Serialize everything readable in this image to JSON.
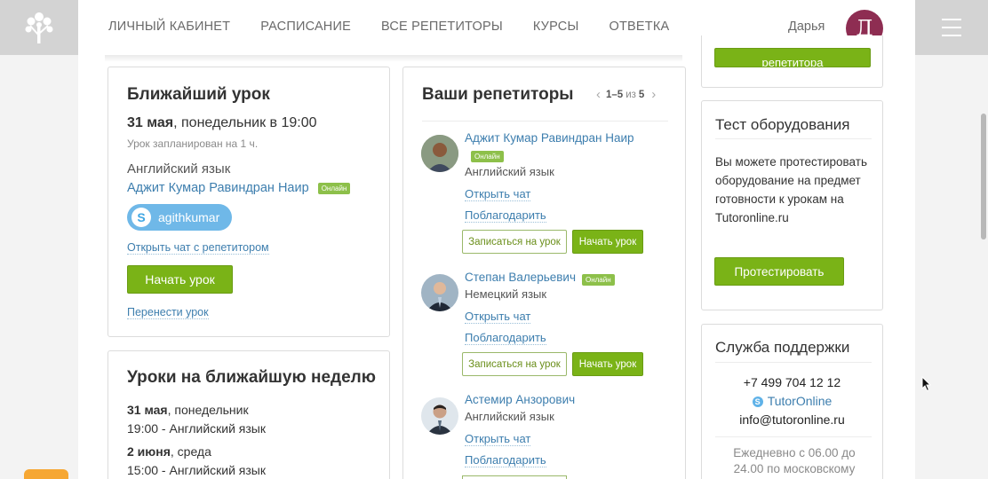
{
  "nav": {
    "items": [
      "ЛИЧНЫЙ КАБИНЕТ",
      "РАСПИСАНИЕ",
      "ВСЕ РЕПЕТИТОРЫ",
      "КУРСЫ",
      "ОТВЕТКА"
    ],
    "user_name": "Дарья",
    "avatar_letter": "Д"
  },
  "next_lesson": {
    "title": "Ближайший урок",
    "date_bold": "31 мая",
    "date_rest": ", понедельник в 19:00",
    "planned": "Урок запланирован на 1 ч.",
    "subject": "Английский язык",
    "tutor": "Аджит Кумар Равиндран Наир",
    "online": "Онлайн",
    "skype": "agithkumar",
    "open_chat": "Открыть чат с репетитором",
    "start": "Начать урок",
    "reschedule": "Перенести урок"
  },
  "week": {
    "title": "Уроки на ближайшую неделю",
    "lessons": [
      {
        "date_bold": "31 мая",
        "date_rest": ", понедельник",
        "line": "19:00 - Английский язык"
      },
      {
        "date_bold": "2 июня",
        "date_rest": ", среда",
        "line": "15:00 - Английский язык"
      }
    ]
  },
  "tutors": {
    "title": "Ваши репетиторы",
    "pager_range": "1–5",
    "pager_of": "из",
    "pager_total": "5",
    "list": [
      {
        "name": "Аджит Кумар Равиндран Наир",
        "online": "Онлайн",
        "subject": "Английский язык",
        "chat": "Открыть чат",
        "thank": "Поблагодарить",
        "book": "Записаться на урок",
        "start": "Начать урок"
      },
      {
        "name": "Степан Валерьевич",
        "online": "Онлайн",
        "subject": "Немецкий язык",
        "chat": "Открыть чат",
        "thank": "Поблагодарить",
        "book": "Записаться на урок",
        "start": "Начать урок"
      },
      {
        "name": "Астемир Анзорович",
        "subject": "Английский язык",
        "chat": "Открыть чат",
        "thank": "Поблагодарить"
      }
    ]
  },
  "top_right_btn": "репетитора",
  "equipment": {
    "title": "Тест оборудования",
    "text": "Вы можете протестировать оборудование на предмет готовности к урокам на Tutoronline.ru",
    "button": "Протестировать"
  },
  "support": {
    "title": "Служба поддержки",
    "phone": "+7 499 704 12 12",
    "skype": "TutorOnline",
    "email": "info@tutoronline.ru",
    "hours": "Ежедневно с 06.00 до 24.00 по московскому"
  },
  "colors": {
    "accent_green": "#7ab317",
    "link_blue": "#3d7eae",
    "avatar_bg": "#8e2d52"
  }
}
